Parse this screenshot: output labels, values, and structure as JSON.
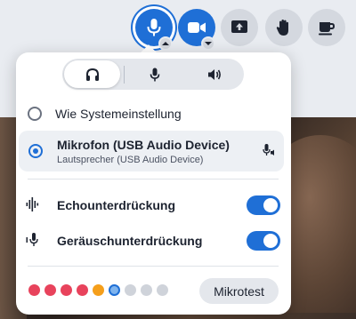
{
  "toolbar": {
    "buttons": [
      {
        "name": "microphone",
        "icon": "microphone-icon",
        "style": "blue",
        "active": true,
        "has_caret": true
      },
      {
        "name": "camera",
        "icon": "video-camera-icon",
        "style": "blue",
        "active": false,
        "has_caret": true
      },
      {
        "name": "share-screen",
        "icon": "share-screen-icon",
        "style": "gray"
      },
      {
        "name": "raise-hand",
        "icon": "hand-icon",
        "style": "gray"
      },
      {
        "name": "break",
        "icon": "coffee-cup-icon",
        "style": "gray"
      }
    ]
  },
  "popover": {
    "tabs": [
      {
        "name": "headset",
        "icon": "headset-icon",
        "selected": true
      },
      {
        "name": "microphone",
        "icon": "microphone-icon",
        "selected": false
      },
      {
        "name": "speaker",
        "icon": "speaker-icon",
        "selected": false
      }
    ],
    "options": {
      "system_label": "Wie Systemeinstellung",
      "device_title": "Mikrofon (USB Audio Device)",
      "device_subtitle": "Lautsprecher (USB Audio Device)"
    },
    "toggles": {
      "echo_label": "Echounterdrückung",
      "echo_on": true,
      "noise_label": "Geräuschunterdrückung",
      "noise_on": true
    },
    "level_meter": {
      "dots": [
        "red",
        "red",
        "red",
        "red",
        "orange",
        "active",
        "gray",
        "gray",
        "gray"
      ]
    },
    "test_button_label": "Mikrotest"
  },
  "colors": {
    "accent": "#1f6fd6",
    "level_red": "#e8435c",
    "level_orange": "#f59f1b",
    "level_active": "#7fb4ee",
    "level_gray": "#cfd3da"
  }
}
